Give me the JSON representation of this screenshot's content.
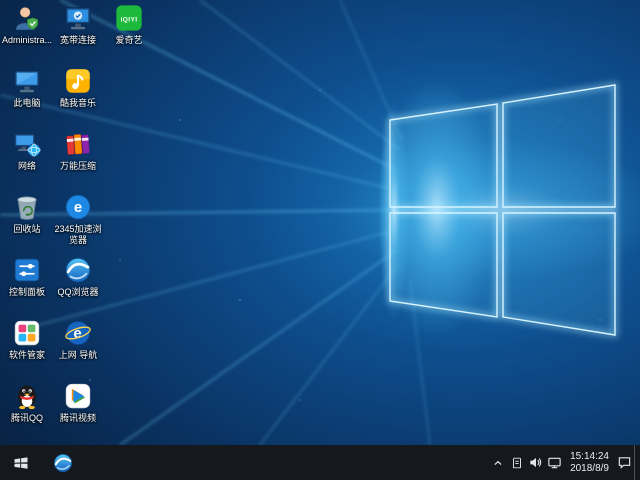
{
  "desktop": {
    "icons": [
      {
        "name": "administrator",
        "icon": "administrator-icon",
        "label": "Administra..."
      },
      {
        "name": "this-pc",
        "icon": "this-pc-icon",
        "label": "此电脑"
      },
      {
        "name": "network",
        "icon": "network-places-icon",
        "label": "网络"
      },
      {
        "name": "recycle-bin",
        "icon": "recycle-bin-icon",
        "label": "回收站"
      },
      {
        "name": "control-panel",
        "icon": "control-panel-icon",
        "label": "控制面板"
      },
      {
        "name": "software-manager",
        "icon": "software-manager-icon",
        "label": "软件管家"
      },
      {
        "name": "tencent-qq",
        "icon": "qq-penguin-icon",
        "label": "腾讯QQ"
      },
      {
        "name": "broadband-connection",
        "icon": "broadband-icon",
        "label": "宽带连接"
      },
      {
        "name": "kuwo-music",
        "icon": "kuwo-music-icon",
        "label": "酷我音乐"
      },
      {
        "name": "wanneng-zip",
        "icon": "zip-archive-icon",
        "label": "万能压缩"
      },
      {
        "name": "2345-browser",
        "icon": "browser-e-icon",
        "label": "2345加速浏览器"
      },
      {
        "name": "qq-browser",
        "icon": "qq-browser-icon",
        "label": "QQ浏览器"
      },
      {
        "name": "web-navigation",
        "icon": "navigation-e-icon",
        "label": "上网 导航"
      },
      {
        "name": "tencent-video",
        "icon": "tencent-video-icon",
        "label": "腾讯视频"
      },
      {
        "name": "iqiyi",
        "icon": "iqiyi-icon",
        "label": "爱奇艺"
      }
    ]
  },
  "logos": {
    "e": "e",
    "iqiyi": "iQIYI"
  },
  "taskbar": {
    "start_icon": "windows-start-icon",
    "pinned_icons": [
      "qq-browser-icon"
    ],
    "tray": {
      "expand_icon": "chevron-up-icon",
      "icons": [
        "document-icon",
        "volume-icon",
        "network-icon"
      ],
      "time": "15:14:24",
      "date": "2018/8/9",
      "action_center_icon": "action-center-icon"
    }
  },
  "colors": {
    "taskbar_bg": "#15181d",
    "wallpaper_base": "#0a3261",
    "wallpaper_glow": "#56c5f7",
    "label_text": "#ffffff"
  }
}
